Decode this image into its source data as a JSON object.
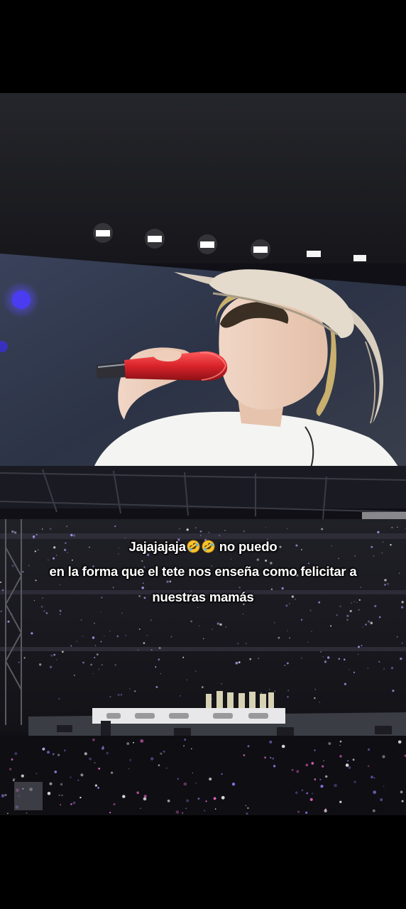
{
  "caption": {
    "line1_text": "Jajajajaja",
    "line1_emojis": [
      "rolling-on-floor-laughing-emoji",
      "rolling-on-floor-laughing-emoji"
    ],
    "line1_suffix": "no puedo",
    "line2": "en la forma que el tete nos enseña como felicitar a",
    "line3": "nuestras mamás"
  },
  "colors": {
    "screen_background": "#2b3040",
    "microphone": "#d8232a",
    "hat": "#d9cfbf",
    "shirt": "#f4f4f2",
    "stage_lights": "#ffffff",
    "crowd_lightsticks": "#b9a3ff",
    "letterbox": "#000000"
  }
}
